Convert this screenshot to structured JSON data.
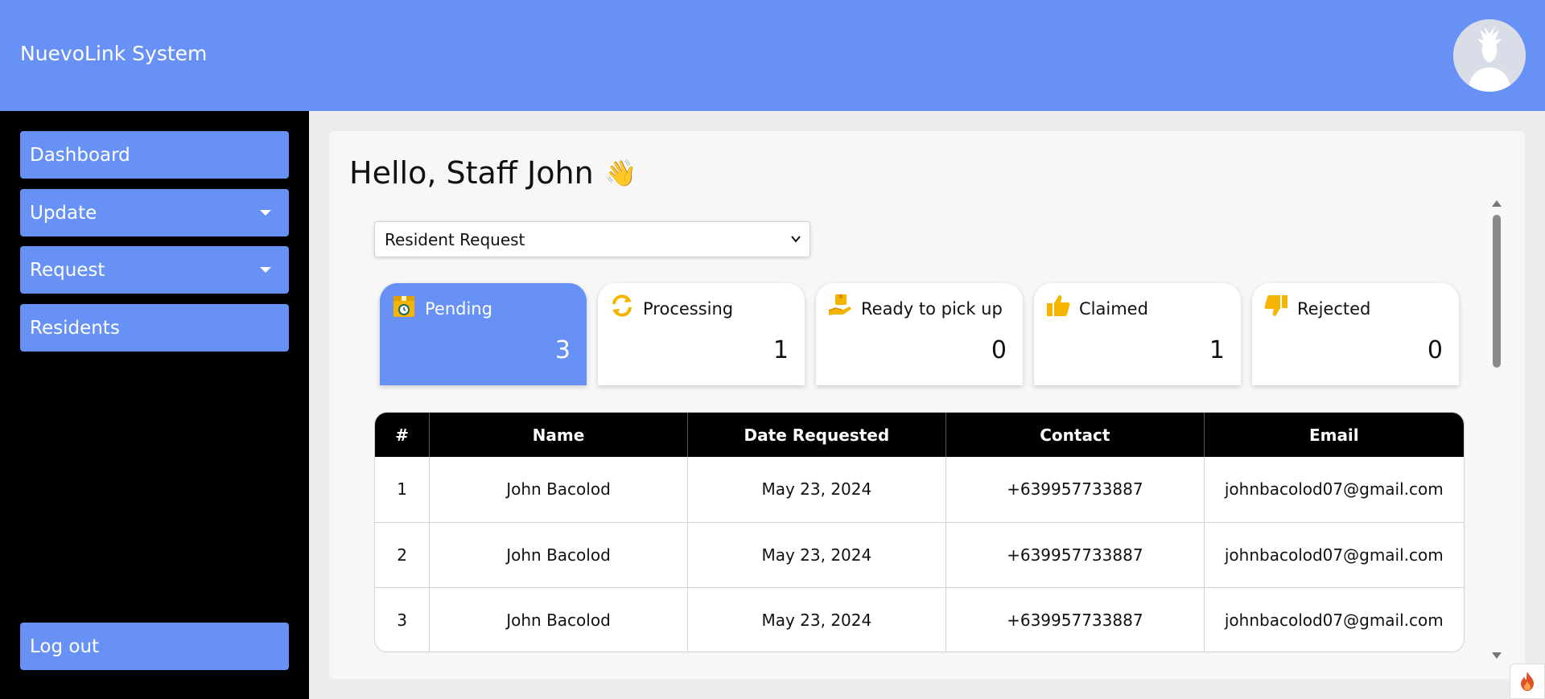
{
  "header": {
    "app_title": "NuevoLink System",
    "avatar_icon": "user-avatar-icon"
  },
  "sidebar": {
    "items": [
      {
        "label": "Dashboard",
        "has_dropdown": false
      },
      {
        "label": "Update",
        "has_dropdown": true
      },
      {
        "label": "Request",
        "has_dropdown": true
      },
      {
        "label": "Residents",
        "has_dropdown": false
      }
    ],
    "logout_label": "Log out"
  },
  "main": {
    "greeting": "Hello, Staff John",
    "greeting_emoji": "👋",
    "request_select": {
      "selected": "Resident Request"
    },
    "status_cards": [
      {
        "label": "Pending",
        "count": "3",
        "icon": "pending-box-clock-icon",
        "active": true
      },
      {
        "label": "Processing",
        "count": "1",
        "icon": "refresh-icon",
        "active": false
      },
      {
        "label": "Ready to pick up",
        "count": "0",
        "icon": "hand-package-icon",
        "active": false
      },
      {
        "label": "Claimed",
        "count": "1",
        "icon": "thumbs-up-icon",
        "active": false
      },
      {
        "label": "Rejected",
        "count": "0",
        "icon": "thumbs-down-icon",
        "active": false
      }
    ],
    "table": {
      "headers": [
        "#",
        "Name",
        "Date Requested",
        "Contact",
        "Email"
      ],
      "rows": [
        [
          "1",
          "John Bacolod",
          "May 23, 2024",
          "+639957733887",
          "johnbacolod07@gmail.com"
        ],
        [
          "2",
          "John Bacolod",
          "May 23, 2024",
          "+639957733887",
          "johnbacolod07@gmail.com"
        ],
        [
          "3",
          "John Bacolod",
          "May 23, 2024",
          "+639957733887",
          "johnbacolod07@gmail.com"
        ]
      ]
    }
  },
  "colors": {
    "primary": "#6791f4",
    "sidebar_bg": "#000000",
    "icon_accent": "#f4b400"
  }
}
